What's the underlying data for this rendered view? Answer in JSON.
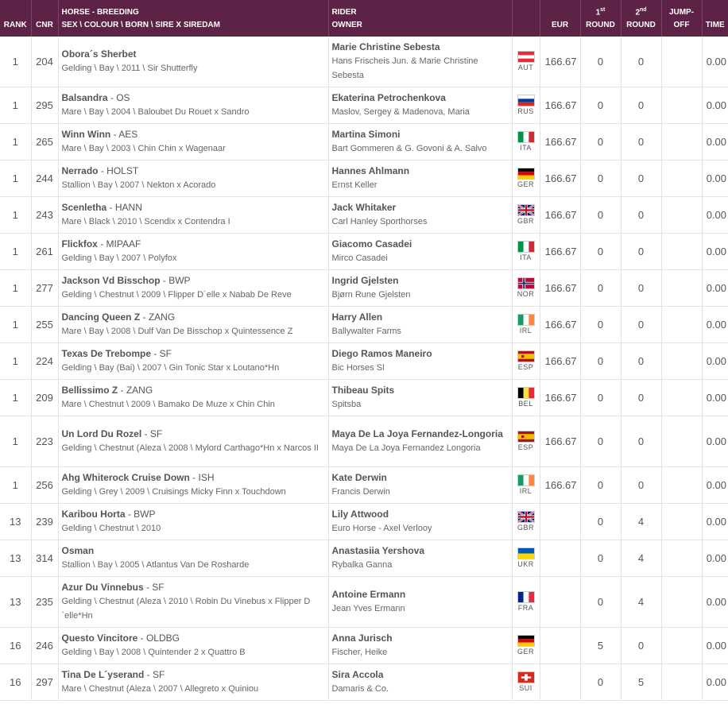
{
  "headers": {
    "rank": "RANK",
    "cnr": "CNR",
    "horse_line1": "HORSE - BREEDING",
    "horse_line2": "SEX \\ COLOUR \\ BORN \\ SIRE X SIREDAM",
    "rider_line1": "RIDER",
    "rider_line2": "OWNER",
    "eur": "EUR",
    "round1_num": "1",
    "round1_sup": "st",
    "round1_label": "ROUND",
    "round2_num": "2",
    "round2_sup": "nd",
    "round2_label": "ROUND",
    "jumpoff_line1": "JUMP-",
    "jumpoff_line2": "OFF",
    "time": "TIME"
  },
  "rows": [
    {
      "rank": "1",
      "cnr": "204",
      "horse": "Obora´s Sherbet",
      "breed": "",
      "detail": "Gelding \\ Bay \\ 2011 \\ Sir Shutterfly",
      "rider": "Marie Christine  Sebesta",
      "owner": "Hans Frischeis Jun. & Marie Christine Sebesta",
      "nat": "AUT",
      "flag": "aut",
      "eur": "166.67",
      "r1": "0",
      "r2": "0",
      "jo": "",
      "time": "0.00"
    },
    {
      "rank": "1",
      "cnr": "295",
      "horse": "Balsandra",
      "breed": " - OS",
      "detail": "Mare \\ Bay \\ 2004 \\ Baloubet Du Rouet x Sandro",
      "rider": "Ekaterina  Petrochenkova",
      "owner": "Maslov, Sergey & Madenova, Maria",
      "nat": "RUS",
      "flag": "rus",
      "eur": "166.67",
      "r1": "0",
      "r2": "0",
      "jo": "",
      "time": "0.00"
    },
    {
      "rank": "1",
      "cnr": "265",
      "horse": "Winn Winn",
      "breed": " - AES",
      "detail": "Mare \\ Bay \\ 2003 \\ Chin Chin x Wagenaar",
      "rider": "Martina  Simoni",
      "owner": "Bart Gommeren & G. Govoni & A. Salvo",
      "nat": "ITA",
      "flag": "ita",
      "eur": "166.67",
      "r1": "0",
      "r2": "0",
      "jo": "",
      "time": "0.00"
    },
    {
      "rank": "1",
      "cnr": "244",
      "horse": "Nerrado",
      "breed": " - HOLST",
      "detail": "Stallion \\ Bay \\ 2007 \\ Nekton x Acorado",
      "rider": "Hannes  Ahlmann",
      "owner": "Ernst Keller",
      "nat": "GER",
      "flag": "ger",
      "eur": "166.67",
      "r1": "0",
      "r2": "0",
      "jo": "",
      "time": "0.00"
    },
    {
      "rank": "1",
      "cnr": "243",
      "horse": "Scenletha",
      "breed": " - HANN",
      "detail": "Mare \\ Black \\ 2010 \\ Scendix x Contendra I",
      "rider": "Jack  Whitaker",
      "owner": "Carl Hanley Sporthorses",
      "nat": "GBR",
      "flag": "gbr",
      "eur": "166.67",
      "r1": "0",
      "r2": "0",
      "jo": "",
      "time": "0.00"
    },
    {
      "rank": "1",
      "cnr": "261",
      "horse": "Flickfox",
      "breed": " - MIPAAF",
      "detail": "Gelding \\ Bay \\ 2007 \\ Polyfox",
      "rider": "Giacomo  Casadei",
      "owner": "Mirco Casadei",
      "nat": "ITA",
      "flag": "ita",
      "eur": "166.67",
      "r1": "0",
      "r2": "0",
      "jo": "",
      "time": "0.00"
    },
    {
      "rank": "1",
      "cnr": "277",
      "horse": "Jackson Vd Bisschop",
      "breed": " - BWP",
      "detail": "Gelding \\ Chestnut \\ 2009 \\ Flipper D´elle x Nabab De Reve",
      "rider": "Ingrid  Gjelsten",
      "owner": "Bjørn Rune Gjelsten",
      "nat": "NOR",
      "flag": "nor",
      "eur": "166.67",
      "r1": "0",
      "r2": "0",
      "jo": "",
      "time": "0.00"
    },
    {
      "rank": "1",
      "cnr": "255",
      "horse": "Dancing Queen Z",
      "breed": " - ZANG",
      "detail": "Mare \\ Bay \\ 2008 \\ Dulf Van De Bisschop x Quintessence Z",
      "rider": "Harry  Allen",
      "owner": "Ballywalter Farms",
      "nat": "IRL",
      "flag": "irl",
      "eur": "166.67",
      "r1": "0",
      "r2": "0",
      "jo": "",
      "time": "0.00"
    },
    {
      "rank": "1",
      "cnr": "224",
      "horse": "Texas De Trebompe",
      "breed": " - SF",
      "detail": "Gelding \\ Bay (Bai) \\ 2007 \\ Gin Tonic Star x Loutano*Hn",
      "rider": "Diego  Ramos Maneiro",
      "owner": "Bic Horses Sl",
      "nat": "ESP",
      "flag": "esp",
      "eur": "166.67",
      "r1": "0",
      "r2": "0",
      "jo": "",
      "time": "0.00"
    },
    {
      "rank": "1",
      "cnr": "209",
      "horse": "Bellissimo Z",
      "breed": " - ZANG",
      "detail": "Mare \\ Chestnut \\ 2009 \\ Bamako De Muze x Chin Chin",
      "rider": "Thibeau  Spits",
      "owner": "Spitsba",
      "nat": "BEL",
      "flag": "bel",
      "eur": "166.67",
      "r1": "0",
      "r2": "0",
      "jo": "",
      "time": "0.00"
    },
    {
      "rank": "1",
      "cnr": "223",
      "horse": "Un Lord Du Rozel",
      "breed": " - SF",
      "detail": "Gelding \\ Chestnut (Aleza \\ 2008 \\ Mylord Carthago*Hn x Narcos II",
      "rider": "Maya  De La Joya Fernandez-Longoria",
      "owner": "Maya De La Joya Fernandez Longoria",
      "nat": "ESP",
      "flag": "esp",
      "eur": "166.67",
      "r1": "0",
      "r2": "0",
      "jo": "",
      "time": "0.00"
    },
    {
      "rank": "1",
      "cnr": "256",
      "horse": "Ahg Whiterock Cruise Down",
      "breed": " - ISH",
      "detail": "Gelding \\ Grey \\ 2009 \\ Cruisings Micky Finn x Touchdown",
      "rider": "Kate  Derwin",
      "owner": "Francis Derwin",
      "nat": "IRL",
      "flag": "irl",
      "eur": "166.67",
      "r1": "0",
      "r2": "0",
      "jo": "",
      "time": "0.00"
    },
    {
      "rank": "13",
      "cnr": "239",
      "horse": "Karibou Horta",
      "breed": " - BWP",
      "detail": "Gelding \\ Chestnut \\ 2010",
      "rider": "Lily  Attwood",
      "owner": "Euro Horse - Axel Verlooy",
      "nat": "GBR",
      "flag": "gbr",
      "eur": "",
      "r1": "0",
      "r2": "4",
      "jo": "",
      "time": "0.00"
    },
    {
      "rank": "13",
      "cnr": "314",
      "horse": "Osman",
      "breed": "",
      "detail": "Stallion \\ Bay \\ 2005 \\ Atlantus Van De Rosharde",
      "rider": "Anastasiia  Yershova",
      "owner": "Rybalka Ganna",
      "nat": "UKR",
      "flag": "ukr",
      "eur": "",
      "r1": "0",
      "r2": "4",
      "jo": "",
      "time": "0.00"
    },
    {
      "rank": "13",
      "cnr": "235",
      "horse": "Azur Du Vinnebus",
      "breed": " - SF",
      "detail": "Gelding \\ Chestnut (Aleza \\ 2010 \\ Robin Du Vinebus x Flipper D´elle*Hn",
      "rider": "Antoine  Ermann",
      "owner": "Jean Yves Ermann",
      "nat": "FRA",
      "flag": "fra",
      "eur": "",
      "r1": "0",
      "r2": "4",
      "jo": "",
      "time": "0.00"
    },
    {
      "rank": "16",
      "cnr": "246",
      "horse": "Questo Vincitore",
      "breed": " - OLDBG",
      "detail": "Gelding \\ Bay \\ 2008 \\ Quintender 2 x Quattro B",
      "rider": "Anna  Jurisch",
      "owner": "Fischer, Heike",
      "nat": "GER",
      "flag": "ger",
      "eur": "",
      "r1": "5",
      "r2": "0",
      "jo": "",
      "time": "0.00"
    },
    {
      "rank": "16",
      "cnr": "297",
      "horse": "Tina De L´yserand",
      "breed": " - SF",
      "detail": "Mare \\ Chestnut (Aleza \\ 2007 \\ Allegreto x Quiniou",
      "rider": "Sira  Accola",
      "owner": "Damaris & Co.",
      "nat": "SUI",
      "flag": "sui",
      "eur": "",
      "r1": "0",
      "r2": "5",
      "jo": "",
      "time": "0.00"
    }
  ]
}
